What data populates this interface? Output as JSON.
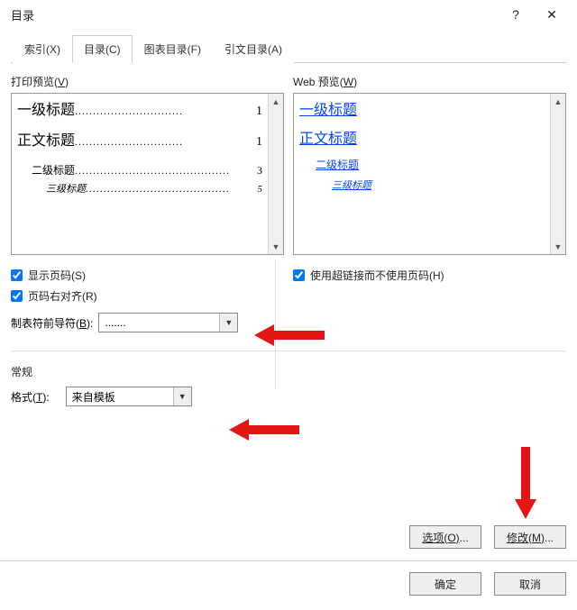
{
  "titlebar": {
    "title": "目录"
  },
  "tabs": {
    "index": "索引(X)",
    "toc": "目录(C)",
    "figures": "图表目录(F)",
    "citations": "引文目录(A)"
  },
  "print_preview": {
    "label_prefix": "打印预览(",
    "label_key": "V",
    "label_suffix": ")",
    "items": [
      {
        "title": "一级标题",
        "page": "1",
        "cls": "h1"
      },
      {
        "title": "正文标题",
        "page": "1",
        "cls": "h1"
      },
      {
        "title": "二级标题",
        "page": "3",
        "cls": "h2"
      },
      {
        "title": "三级标题",
        "page": "5",
        "cls": "h3"
      }
    ]
  },
  "web_preview": {
    "label_prefix": "Web 预览(",
    "label_key": "W",
    "label_suffix": ")",
    "items": [
      {
        "title": "一级标题",
        "cls": "h1"
      },
      {
        "title": "正文标题",
        "cls": "h1"
      },
      {
        "title": "二级标题",
        "cls": "h2"
      },
      {
        "title": "三级标题",
        "cls": "h3"
      }
    ]
  },
  "checkboxes": {
    "show_page": "显示页码(S)",
    "right_align": "页码右对齐(R)",
    "hyperlinks": "使用超链接而不使用页码(H)"
  },
  "leader": {
    "label_prefix": "制表符前导符(",
    "label_key": "B",
    "label_suffix": "):",
    "value": "......."
  },
  "group": {
    "general": "常规"
  },
  "format": {
    "label_prefix": "格式(",
    "label_key": "T",
    "label_suffix": "):",
    "value": "来自模板"
  },
  "buttons": {
    "options": "选项(O)...",
    "modify": "修改(M)...",
    "ok": "确定",
    "cancel": "取消"
  }
}
